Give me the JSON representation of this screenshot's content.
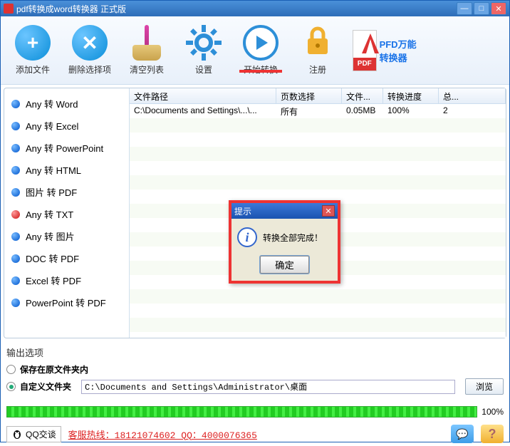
{
  "title": "pdf转换成word转换器 正式版",
  "toolbar": {
    "add": "添加文件",
    "del": "删除选择项",
    "clear": "清空列表",
    "settings": "设置",
    "start": "开始转换",
    "register": "注册",
    "brand": "PFD万能转换器",
    "pdf_badge": "PDF"
  },
  "sidebar": [
    {
      "label": "Any 转 Word",
      "dot": "blue"
    },
    {
      "label": "Any 转 Excel",
      "dot": "blue"
    },
    {
      "label": "Any 转 PowerPoint",
      "dot": "blue"
    },
    {
      "label": "Any 转 HTML",
      "dot": "blue"
    },
    {
      "label": "图片 转 PDF",
      "dot": "blue"
    },
    {
      "label": "Any 转 TXT",
      "dot": "red"
    },
    {
      "label": "Any 转 图片",
      "dot": "blue"
    },
    {
      "label": "DOC 转 PDF",
      "dot": "blue"
    },
    {
      "label": "Excel 转 PDF",
      "dot": "blue"
    },
    {
      "label": "PowerPoint 转 PDF",
      "dot": "blue"
    }
  ],
  "table": {
    "headers": [
      "文件路径",
      "页数选择",
      "文件...",
      "转换进度",
      "总..."
    ],
    "rows": [
      {
        "path": "C:\\Documents and Settings\\...\\...",
        "pages": "所有",
        "size": "0.05MB",
        "progress": "100%",
        "total": "2"
      }
    ]
  },
  "output": {
    "header": "输出选项",
    "opt1": "保存在原文件夹内",
    "opt2": "自定义文件夹",
    "path": "C:\\Documents and Settings\\Administrator\\桌面",
    "browse": "浏览"
  },
  "progress_text": "100%",
  "footer": {
    "qq": "QQ交谈",
    "hotline": "客服热线：18121074602 QQ：4000076365"
  },
  "dialog": {
    "title": "提示",
    "message": "转换全部完成！",
    "ok": "确定"
  }
}
